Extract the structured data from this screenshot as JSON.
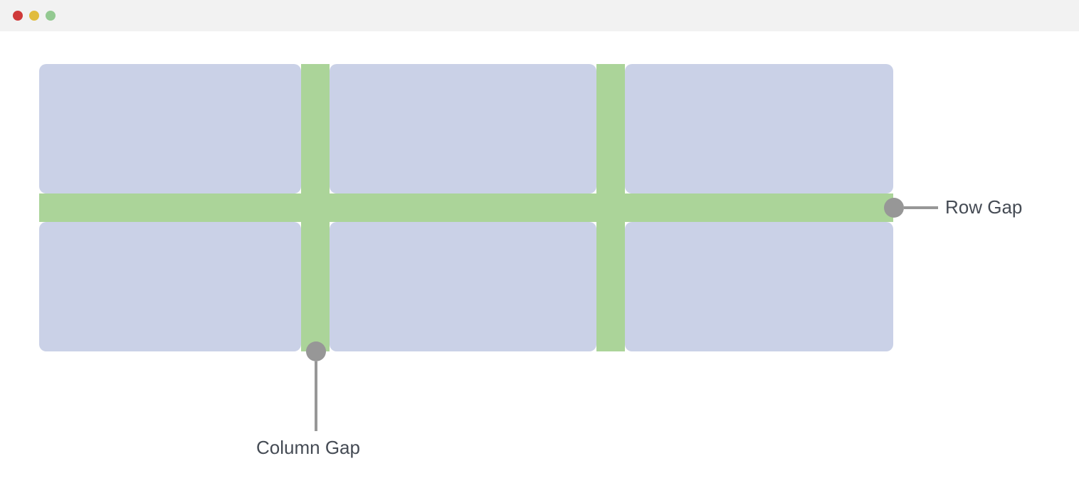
{
  "diagram": {
    "labels": {
      "row_gap": "Row Gap",
      "column_gap": "Column Gap"
    },
    "colors": {
      "gap_highlight": "#abd499",
      "cell": "#cad1e7",
      "callout": "#979797",
      "text": "#454b54",
      "titlebar_bg": "#f2f2f2",
      "traffic_red": "#cf3939",
      "traffic_yellow": "#e1bc3c",
      "traffic_green": "#93c991"
    },
    "grid": {
      "columns": 3,
      "rows": 2,
      "cells": 6
    }
  }
}
